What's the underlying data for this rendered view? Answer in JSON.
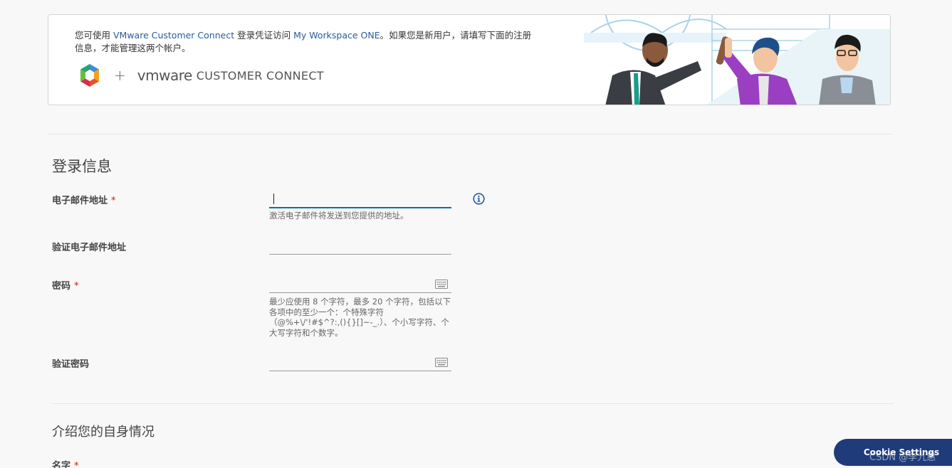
{
  "banner": {
    "line1_pre": "您可使用 ",
    "line1_hl1": "VMware Customer Connect",
    "line1_mid": " 登录凭证访问 ",
    "line1_hl2": "My Workspace ONE",
    "line1_post": "。如果您是新用户，请填写下面的注册",
    "line2": "信息，才能管理这两个帐户。",
    "plus": "+",
    "vmware_text": "vmware",
    "connect_text": "CUSTOMER CONNECT"
  },
  "login_section": {
    "title": "登录信息",
    "email": {
      "label": "电子邮件地址",
      "required": "*",
      "value": "",
      "hint": "激活电子邮件将发送到您提供的地址。"
    },
    "confirm_email": {
      "label": "验证电子邮件地址",
      "value": ""
    },
    "password": {
      "label": "密码",
      "required": "*",
      "value": "",
      "hint": "最少应使用 8 个字符，最多 20 个字符，包括以下各项中的至少一个：个特殊字符（@%+\\/'!#$^?:,(){}[]~-_.）、个小写字符、个大写字符和个数字。"
    },
    "confirm_password": {
      "label": "验证密码",
      "value": ""
    }
  },
  "profile_section": {
    "title": "介绍您的自身情况",
    "first_name": {
      "label": "名字",
      "required": "*"
    }
  },
  "cookie_button": "Cookie Settings",
  "watermark": "CSDN @李九惠",
  "colors": {
    "accent": "#0072a3",
    "required": "#c21d00",
    "cookie_bg": "#1f3b7a",
    "link": "#2a5b9a"
  }
}
